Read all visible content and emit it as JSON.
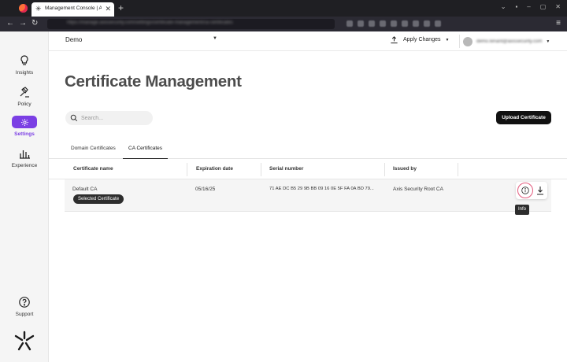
{
  "browser": {
    "tab_title": "Management Console | Axis Se",
    "tab_close": "✕",
    "new_tab": "+",
    "url": "https://manage.axissecurity.com/settings/certificate-management/ca-certificates",
    "back": "←",
    "forward": "→",
    "reload": "↻",
    "menu": "≡"
  },
  "header": {
    "tenant": "Demo",
    "apply_changes": "Apply Changes",
    "user_email": "demo.tenant@axissecurity.com"
  },
  "sidebar": {
    "items": [
      {
        "label": "Insights",
        "icon": "lightbulb-icon"
      },
      {
        "label": "Policy",
        "icon": "gavel-icon"
      },
      {
        "label": "Settings",
        "icon": "gear-icon",
        "active": true
      },
      {
        "label": "Experience",
        "icon": "bar-chart-icon"
      }
    ],
    "support": "Support"
  },
  "main": {
    "page_title": "Certificate Management",
    "search_placeholder": "Search...",
    "upload_button": "Upload Certificate",
    "tabs": [
      {
        "label": "Domain Certificates",
        "active": false
      },
      {
        "label": "CA Certificates",
        "active": true
      }
    ],
    "table": {
      "columns": [
        "Certificate name",
        "Expiration date",
        "Serial number",
        "Issued by"
      ],
      "rows": [
        {
          "name": "Default CA",
          "badge": "Selected Certificate",
          "expiration": "05/16/25",
          "serial": "71 AE DC B5 29 9B BB 09 16 0E 5F FA 0A BD 79...",
          "issued_by": "Axis Security Root CA"
        }
      ]
    },
    "tooltip": "Info"
  },
  "colors": {
    "accent": "#7b3fe4",
    "focus_ring": "#e35a7d"
  }
}
